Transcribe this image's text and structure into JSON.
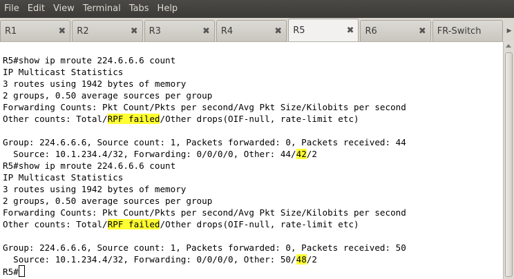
{
  "menu": [
    "File",
    "Edit",
    "View",
    "Terminal",
    "Tabs",
    "Help"
  ],
  "tabs": [
    {
      "label": "R1",
      "active": false
    },
    {
      "label": "R2",
      "active": false
    },
    {
      "label": "R3",
      "active": false
    },
    {
      "label": "R4",
      "active": false
    },
    {
      "label": "R5",
      "active": true
    },
    {
      "label": "R6",
      "active": false
    },
    {
      "label": "FR-Switch",
      "active": false
    }
  ],
  "terminal": {
    "highlight_color": "#ffff32",
    "lines": [
      [
        {
          "t": "R5#show ip mroute 224.6.6.6 count"
        }
      ],
      [
        {
          "t": "IP Multicast Statistics"
        }
      ],
      [
        {
          "t": "3 routes using 1942 bytes of memory"
        }
      ],
      [
        {
          "t": "2 groups, 0.50 average sources per group"
        }
      ],
      [
        {
          "t": "Forwarding Counts: Pkt Count/Pkts per second/Avg Pkt Size/Kilobits per second"
        }
      ],
      [
        {
          "t": "Other counts: Total/"
        },
        {
          "t": "RPF failed",
          "hl": true
        },
        {
          "t": "/Other drops(OIF-null, rate-limit etc)"
        }
      ],
      [
        {
          "t": ""
        }
      ],
      [
        {
          "t": "Group: 224.6.6.6, Source count: 1, Packets forwarded: 0, Packets received: 44"
        }
      ],
      [
        {
          "t": "  Source: 10.1.234.4/32, Forwarding: 0/0/0/0, Other: 44/"
        },
        {
          "t": "42",
          "hl": true
        },
        {
          "t": "/2"
        }
      ],
      [
        {
          "t": "R5#show ip mroute 224.6.6.6 count"
        }
      ],
      [
        {
          "t": "IP Multicast Statistics"
        }
      ],
      [
        {
          "t": "3 routes using 1942 bytes of memory"
        }
      ],
      [
        {
          "t": "2 groups, 0.50 average sources per group"
        }
      ],
      [
        {
          "t": "Forwarding Counts: Pkt Count/Pkts per second/Avg Pkt Size/Kilobits per second"
        }
      ],
      [
        {
          "t": "Other counts: Total/"
        },
        {
          "t": "RPF failed",
          "hl": true
        },
        {
          "t": "/Other drops(OIF-null, rate-limit etc)"
        }
      ],
      [
        {
          "t": ""
        }
      ],
      [
        {
          "t": "Group: 224.6.6.6, Source count: 1, Packets forwarded: 0, Packets received: 50"
        }
      ],
      [
        {
          "t": "  Source: 10.1.234.4/32, Forwarding: 0/0/0/0, Other: 50/"
        },
        {
          "t": "48",
          "hl": true
        },
        {
          "t": "/2"
        }
      ],
      [
        {
          "t": "R5#"
        }
      ]
    ]
  }
}
